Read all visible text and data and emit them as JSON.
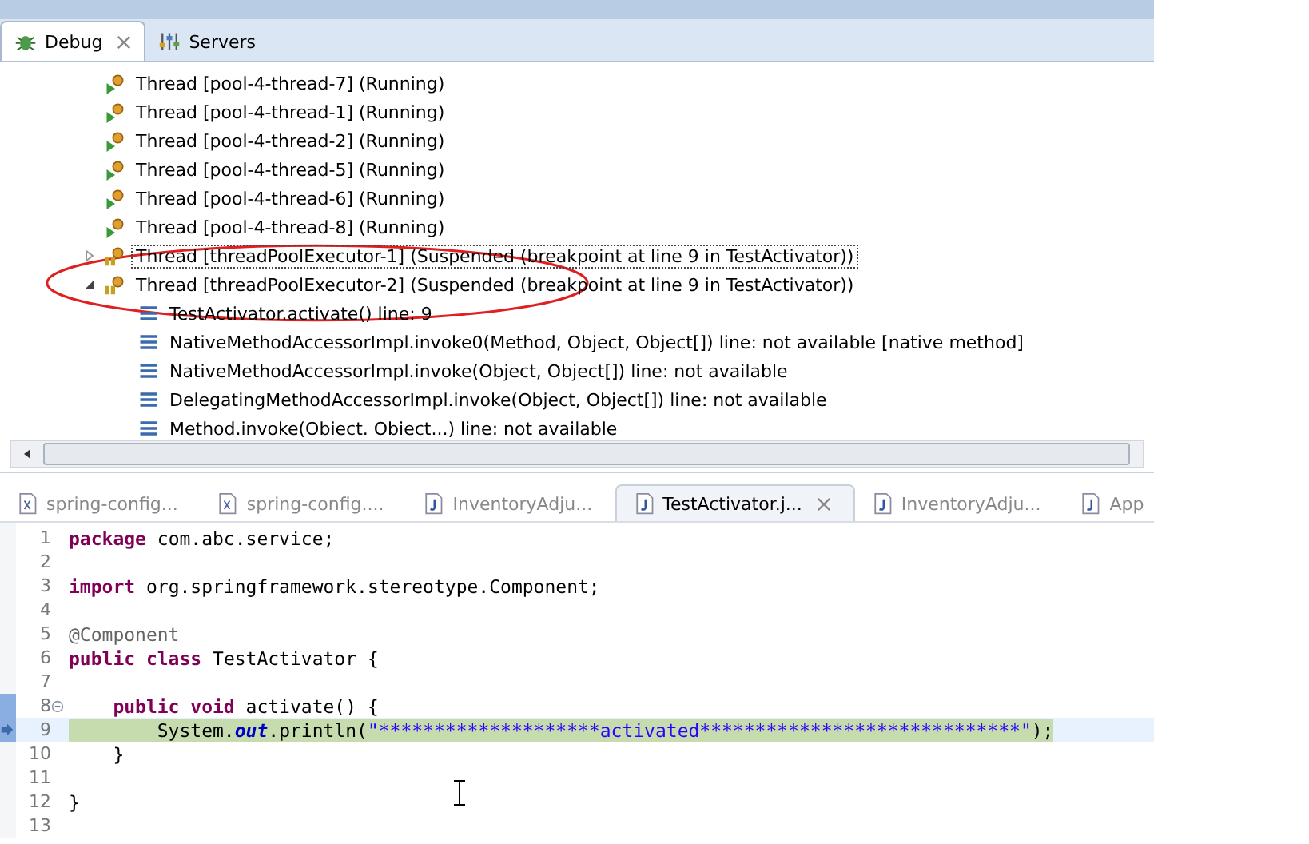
{
  "debug_view": {
    "tabs": [
      {
        "label": "Debug",
        "kind": "bug",
        "selected": true
      },
      {
        "label": "Servers",
        "kind": "servers",
        "selected": false
      }
    ],
    "threads": [
      {
        "label": "Thread [pool-4-thread-7] (Running)",
        "kind": "running",
        "selected": false
      },
      {
        "label": "Thread [pool-4-thread-1] (Running)",
        "kind": "running",
        "selected": false
      },
      {
        "label": "Thread [pool-4-thread-2] (Running)",
        "kind": "running",
        "selected": false
      },
      {
        "label": "Thread [pool-4-thread-5] (Running)",
        "kind": "running",
        "selected": false
      },
      {
        "label": "Thread [pool-4-thread-6] (Running)",
        "kind": "running",
        "selected": false
      },
      {
        "label": "Thread [pool-4-thread-8] (Running)",
        "kind": "running",
        "selected": false
      },
      {
        "label": "Thread [threadPoolExecutor-1] (Suspended (breakpoint at line 9 in TestActivator))",
        "kind": "suspended",
        "selected": true,
        "expanded": false
      },
      {
        "label": "Thread [threadPoolExecutor-2] (Suspended (breakpoint at line 9 in TestActivator))",
        "kind": "suspended",
        "selected": false,
        "expanded": true,
        "children": [
          {
            "label": "TestActivator.activate() line: 9"
          },
          {
            "label": "NativeMethodAccessorImpl.invoke0(Method, Object, Object[]) line: not available [native method]"
          },
          {
            "label": "NativeMethodAccessorImpl.invoke(Object, Object[]) line: not available"
          },
          {
            "label": "DelegatingMethodAccessorImpl.invoke(Object, Object[]) line: not available"
          },
          {
            "label": "Method.invoke(Obiect. Obiect...) line: not available"
          }
        ]
      }
    ]
  },
  "editor": {
    "tabs": [
      {
        "label": "spring-config...",
        "kind": "xml",
        "selected": false
      },
      {
        "label": "spring-config....",
        "kind": "xml",
        "selected": false
      },
      {
        "label": "InventoryAdju...",
        "kind": "java",
        "selected": false
      },
      {
        "label": "TestActivator.j...",
        "kind": "java",
        "selected": true
      },
      {
        "label": "InventoryAdju...",
        "kind": "java",
        "selected": false
      },
      {
        "label": "App",
        "kind": "java",
        "selected": false
      }
    ],
    "lines": [
      {
        "number": "1",
        "segments": [
          {
            "kind": "keyword",
            "text": "package"
          },
          {
            "kind": "plain",
            "text": " com.abc.service;"
          }
        ]
      },
      {
        "number": "2"
      },
      {
        "number": "3",
        "segments": [
          {
            "kind": "keyword",
            "text": "import"
          },
          {
            "kind": "plain",
            "text": " org.springframework.stereotype.Component;"
          }
        ]
      },
      {
        "number": "4"
      },
      {
        "number": "5",
        "segments": [
          {
            "kind": "annotation",
            "text": "@Component"
          }
        ]
      },
      {
        "number": "6",
        "segments": [
          {
            "kind": "keyword",
            "text": "public class"
          },
          {
            "kind": "plain",
            "text": " TestActivator {"
          }
        ]
      },
      {
        "number": "7"
      },
      {
        "number": "8",
        "folding": true,
        "segments": [
          {
            "kind": "keyword",
            "text": "    public void"
          },
          {
            "kind": "plain",
            "text": " activate() {"
          }
        ]
      },
      {
        "number": "9",
        "current": true,
        "segments": [
          {
            "kind": "plain",
            "text": "        System."
          },
          {
            "kind": "field",
            "text": "out"
          },
          {
            "kind": "plain",
            "text": ".println("
          },
          {
            "kind": "string",
            "text": "\"********************activated*****************************\""
          },
          {
            "kind": "plain",
            "text": ");"
          }
        ]
      },
      {
        "number": "10",
        "segments": [
          {
            "kind": "plain",
            "text": "    }"
          }
        ]
      },
      {
        "number": "11"
      },
      {
        "number": "12",
        "segments": [
          {
            "kind": "plain",
            "text": "}"
          }
        ]
      },
      {
        "number": "13"
      }
    ]
  }
}
